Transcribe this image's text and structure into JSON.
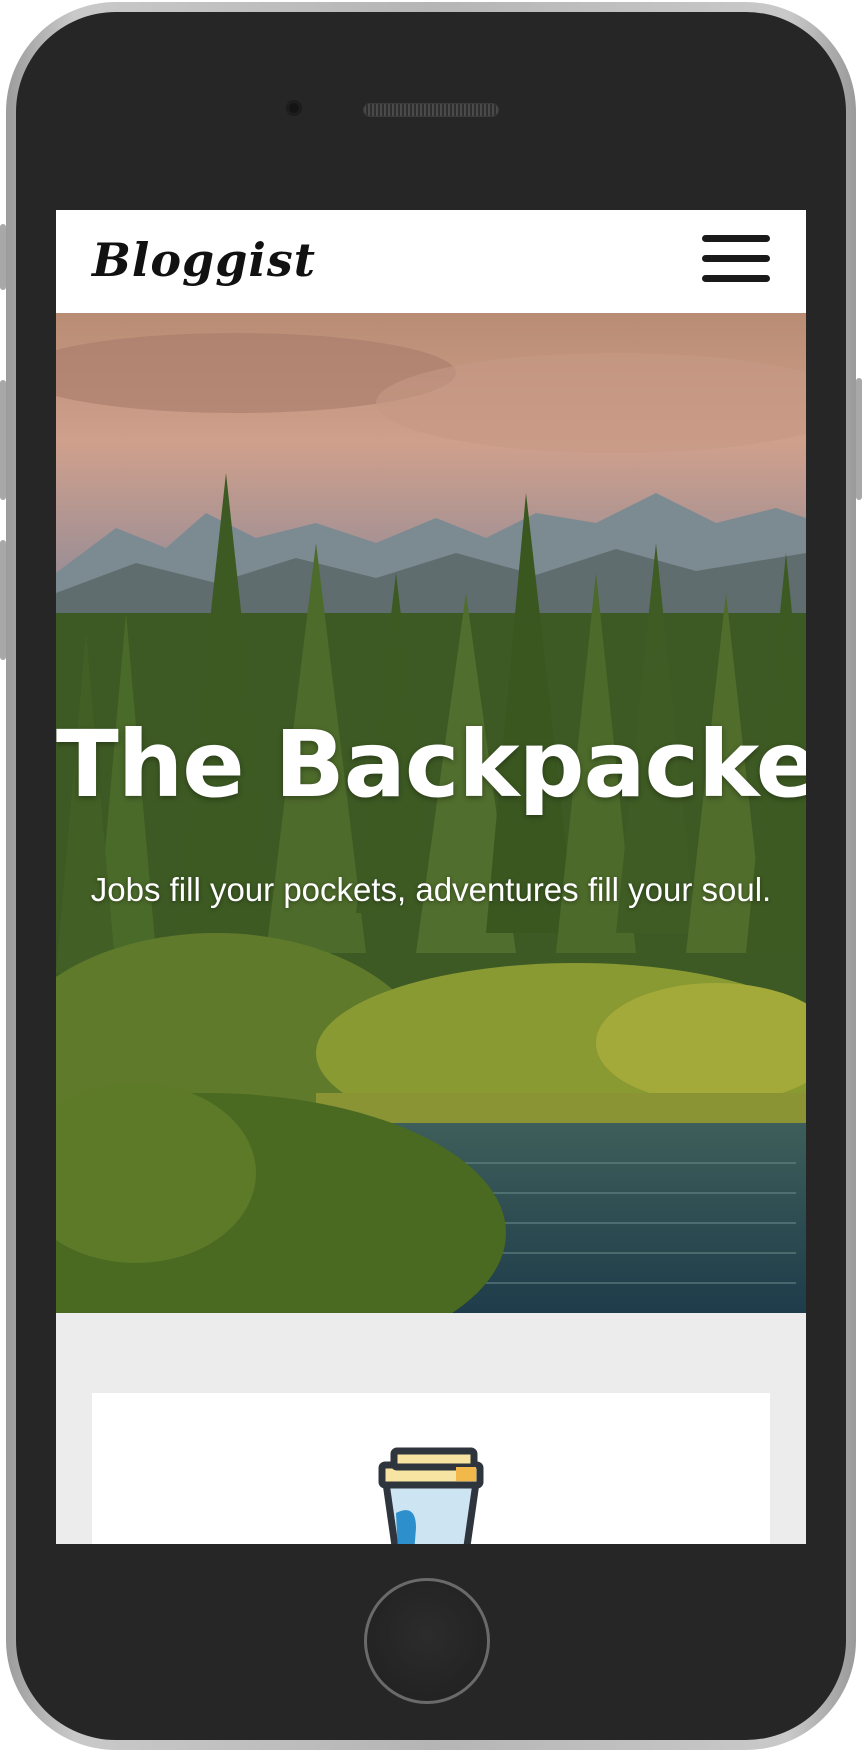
{
  "site": {
    "logo": "Bloggist",
    "menu_icon": "hamburger-menu-icon"
  },
  "hero": {
    "title": "The Backpacker",
    "subtitle": "Jobs fill your pockets, adventures fill your soul."
  },
  "card": {
    "icon": "coffee-cup-icon"
  },
  "colors": {
    "navbar_bg": "#ffffff",
    "page_bg": "#ececec",
    "phone_body": "#262626"
  }
}
